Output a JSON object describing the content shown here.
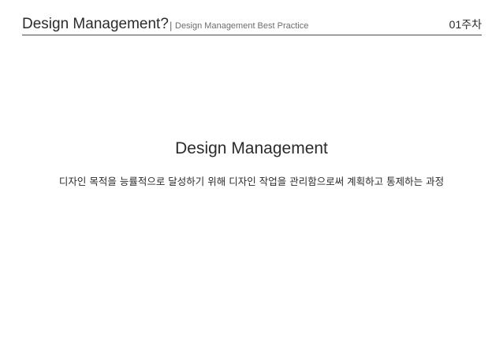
{
  "header": {
    "title": "Design Management?",
    "separator": "|",
    "subtitle": "Design Management Best Practice",
    "week": "01주차"
  },
  "main": {
    "title": "Design Management",
    "definition": "디자인 목적을 능률적으로 달성하기 위해 디자인 작업을 관리함으로써 계획하고 통제하는 과정"
  }
}
